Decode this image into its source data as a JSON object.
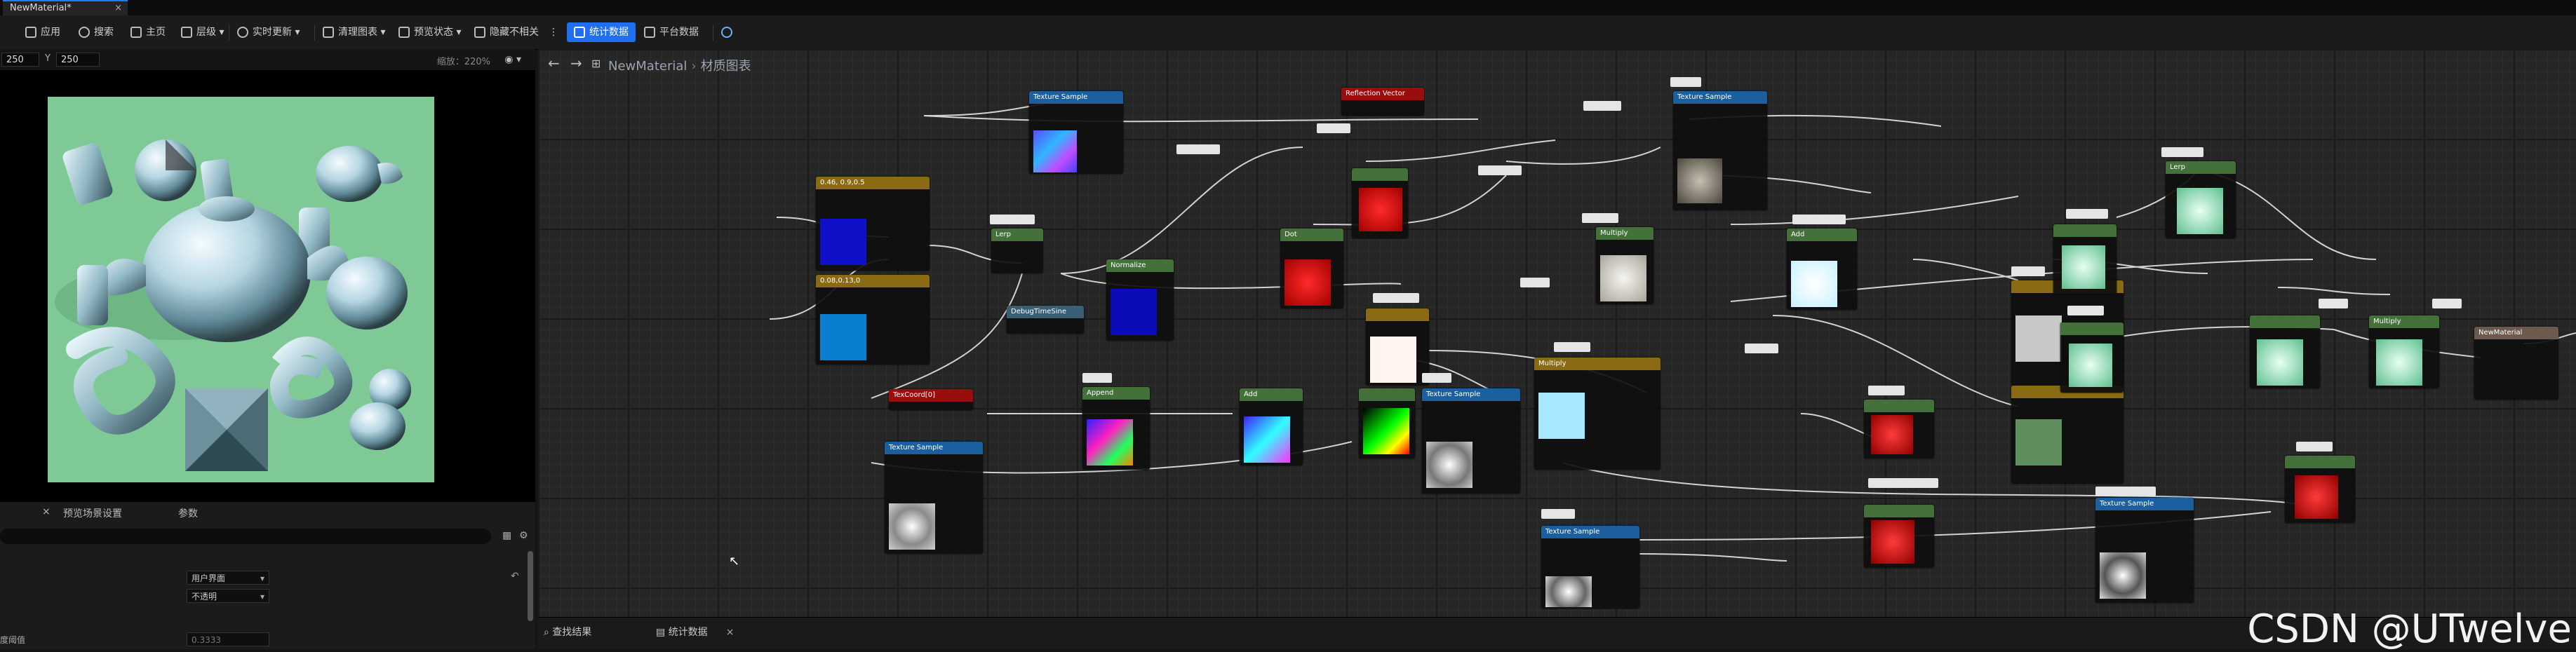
{
  "document_tab": {
    "title": "NewMaterial*",
    "close": "×"
  },
  "toolbar": {
    "items": [
      "应用",
      "搜索",
      "主页",
      "层级",
      "实时更新",
      "清理图表",
      "预览状态",
      "隐藏不相关",
      "统计数据",
      "平台数据"
    ],
    "active": "统计数据",
    "overflow": "⋮"
  },
  "viewport": {
    "x_value": "250",
    "y_label": "Y",
    "y_value": "250",
    "zoom": "缩放：220%",
    "eye": "◉ ▾"
  },
  "details": {
    "tab1": "预览场景设置",
    "tab2": "参数",
    "row1_value": "用户界面",
    "row2_value": "不透明",
    "row3_label": "度阈值",
    "row3_value": "0.3333"
  },
  "graph": {
    "back": "←",
    "forward": "→",
    "breadcrumb_root": "NewMaterial",
    "breadcrumb_sep": "›",
    "breadcrumb_leaf": "材质图表",
    "nodes": [
      {
        "title": "Texture Sample",
        "color": "#1c5f9f"
      },
      {
        "title": "Reflection Vector",
        "color": "#9a0d0d"
      },
      {
        "title": "Texture Sample",
        "color": "#1c5f9f"
      },
      {
        "title": "0.46, 0.9,0.5",
        "color": "#8a6a12"
      },
      {
        "title": "0.08,0.13,0",
        "color": "#8a6a12"
      },
      {
        "title": "Lerp",
        "color": "#44703a"
      },
      {
        "title": "Normalize",
        "color": "#44703a"
      },
      {
        "title": "DebugTimeSine",
        "color": "#3a5f75"
      },
      {
        "title": "TexCoord[0]",
        "color": "#9a0d0d"
      },
      {
        "title": "Texture Sample",
        "color": "#1c5f9f"
      },
      {
        "title": "Dot",
        "color": "#44703a"
      },
      {
        "title": "Multiply",
        "color": "#44703a"
      },
      {
        "title": "Append",
        "color": "#44703a"
      },
      {
        "title": "Add",
        "color": "#44703a"
      },
      {
        "title": "Texture Sample",
        "color": "#1c5f9f"
      },
      {
        "title": "Multiply",
        "color": "#44703a"
      },
      {
        "title": "Add",
        "color": "#44703a"
      },
      {
        "title": "Texture Sample",
        "color": "#1c5f9f"
      },
      {
        "title": "Lerp",
        "color": "#44703a"
      },
      {
        "title": "Multiply",
        "color": "#44703a"
      },
      {
        "title": "NewMaterial",
        "color": "#6d5a4e"
      },
      {
        "title": "Texture Sample",
        "color": "#1c5f9f"
      }
    ]
  },
  "bottom_tabs": {
    "find": "查找结果",
    "stats": "统计数据",
    "close": "×"
  },
  "watermark": "CSDN @UTwelve",
  "faint_text": "材质"
}
